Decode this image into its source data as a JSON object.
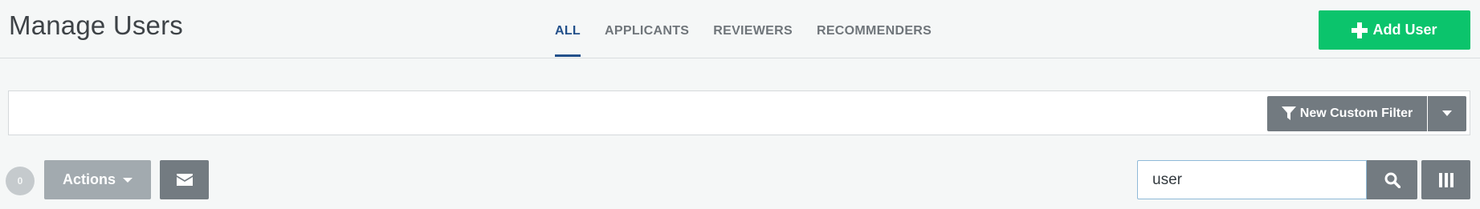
{
  "header": {
    "title": "Manage Users",
    "tabs": [
      {
        "label": "ALL",
        "active": true
      },
      {
        "label": "APPLICANTS",
        "active": false
      },
      {
        "label": "REVIEWERS",
        "active": false
      },
      {
        "label": "RECOMMENDERS",
        "active": false
      }
    ],
    "add_user_label": "Add User",
    "add_user_icon": "plus-icon"
  },
  "filter_bar": {
    "new_filter_label": "New Custom Filter",
    "new_filter_icon": "filter-icon",
    "dropdown_icon": "caret-down-icon"
  },
  "toolbar": {
    "selected_count": "0",
    "actions_label": "Actions",
    "actions_icon": "caret-down-icon",
    "email_icon": "envelope-icon",
    "search_value": "user",
    "search_icon": "search-icon",
    "columns_icon": "columns-icon"
  },
  "colors": {
    "background": "#f5f7f7",
    "accent_blue": "#22508a",
    "add_button": "#0bc46c",
    "dark_button": "#737b81",
    "actions_button": "#a2aaaf",
    "tab_inactive": "#6f757a",
    "title": "#3e4347"
  }
}
